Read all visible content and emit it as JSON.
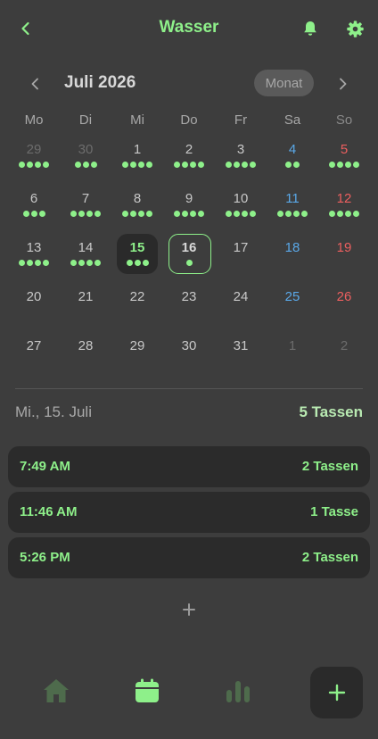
{
  "header": {
    "title": "Wasser",
    "back_icon": "chevron-left-icon",
    "bell_icon": "bell-icon",
    "settings_icon": "gear-icon",
    "accent": "#8ef08a"
  },
  "calendar": {
    "month_label": "Juli 2026",
    "view_toggle": "Monat",
    "weekdays": [
      "Mo",
      "Di",
      "Mi",
      "Do",
      "Fr",
      "Sa",
      "So"
    ],
    "selected_day": 15,
    "today_day": 16,
    "weeks": [
      [
        {
          "d": "29",
          "other": true,
          "cups": 4
        },
        {
          "d": "30",
          "other": true,
          "cups": 3
        },
        {
          "d": "1",
          "cups": 4
        },
        {
          "d": "2",
          "cups": 4
        },
        {
          "d": "3",
          "cups": 4
        },
        {
          "d": "4",
          "cups": 2
        },
        {
          "d": "5",
          "cups": 4
        }
      ],
      [
        {
          "d": "6",
          "cups": 3
        },
        {
          "d": "7",
          "cups": 4
        },
        {
          "d": "8",
          "cups": 4
        },
        {
          "d": "9",
          "cups": 4
        },
        {
          "d": "10",
          "cups": 4
        },
        {
          "d": "11",
          "cups": 4
        },
        {
          "d": "12",
          "cups": 4
        }
      ],
      [
        {
          "d": "13",
          "cups": 4
        },
        {
          "d": "14",
          "cups": 4
        },
        {
          "d": "15",
          "cups": 3
        },
        {
          "d": "16",
          "cups": 1
        },
        {
          "d": "17",
          "cups": 0
        },
        {
          "d": "18",
          "cups": 0
        },
        {
          "d": "19",
          "cups": 0
        }
      ],
      [
        {
          "d": "20",
          "cups": 0
        },
        {
          "d": "21",
          "cups": 0
        },
        {
          "d": "22",
          "cups": 0
        },
        {
          "d": "23",
          "cups": 0
        },
        {
          "d": "24",
          "cups": 0
        },
        {
          "d": "25",
          "cups": 0
        },
        {
          "d": "26",
          "cups": 0
        }
      ],
      [
        {
          "d": "27",
          "cups": 0
        },
        {
          "d": "28",
          "cups": 0
        },
        {
          "d": "29",
          "cups": 0
        },
        {
          "d": "30",
          "cups": 0
        },
        {
          "d": "31",
          "cups": 0
        },
        {
          "d": "1",
          "other": true,
          "cups": 0
        },
        {
          "d": "2",
          "other": true,
          "cups": 0
        }
      ]
    ],
    "colors": {
      "saturday": "#5aa8e8",
      "sunday": "#ec5f5f",
      "dot": "#8ef08a"
    }
  },
  "day_summary": {
    "date": "Mi., 15. Juli",
    "total": "5 Tassen"
  },
  "entries": [
    {
      "time": "7:49 AM",
      "amount": "2 Tassen"
    },
    {
      "time": "11:46 AM",
      "amount": "1 Tasse"
    },
    {
      "time": "5:26 PM",
      "amount": "2 Tassen"
    }
  ],
  "add_entry_icon": "plus-icon",
  "tabbar": {
    "items": [
      {
        "icon": "home-icon",
        "active": false
      },
      {
        "icon": "calendar-icon",
        "active": true
      },
      {
        "icon": "bar-chart-icon",
        "active": false
      }
    ],
    "fab_icon": "plus-icon"
  }
}
